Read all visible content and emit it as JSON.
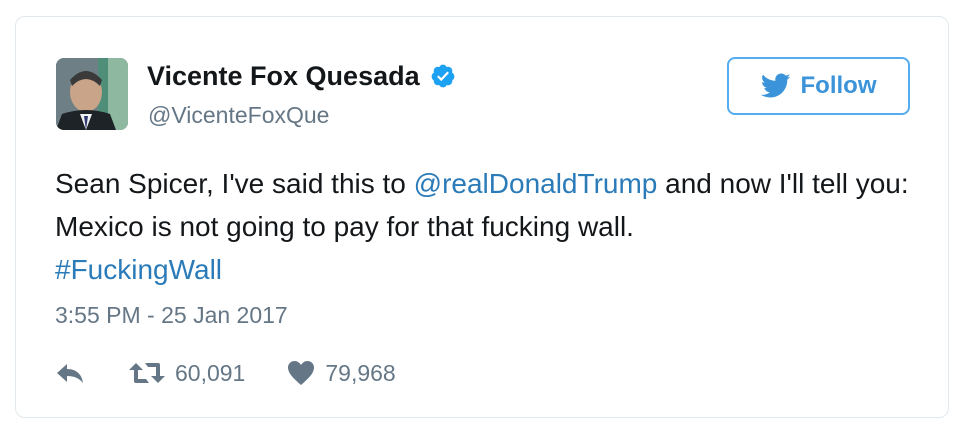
{
  "tweet": {
    "author": {
      "name": "Vicente Fox Quesada",
      "handle": "@VicenteFoxQue",
      "verified": true
    },
    "follow_label": "Follow",
    "text": {
      "part1": "Sean Spicer, I've said this to ",
      "mention": "@realDonaldTrump",
      "part2": " and now I'll tell you: Mexico is not going to pay for that fucking wall.",
      "hashtag": "#FuckingWall"
    },
    "timestamp": "3:55 PM - 25 Jan 2017",
    "actions": {
      "retweet_count": "60,091",
      "like_count": "79,968"
    },
    "icons": {
      "avatar": "profile-photo",
      "verified": "verified-badge-icon",
      "follow": "twitter-bird-icon",
      "reply": "reply-icon",
      "retweet": "retweet-icon",
      "like": "heart-icon"
    },
    "colors": {
      "link": "#2b7bb9",
      "follow": "#3b94d9",
      "muted": "#657786",
      "verified": "#1da1f2"
    }
  }
}
